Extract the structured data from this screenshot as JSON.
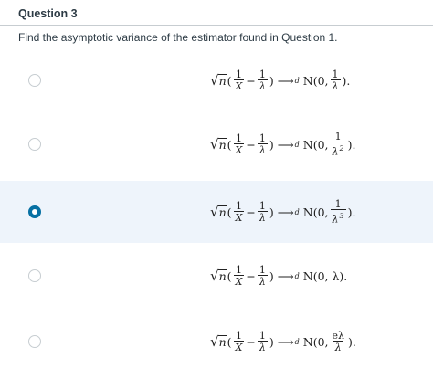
{
  "question": {
    "title": "Question 3",
    "prompt": "Find the asymptotic variance of the estimator found in Question 1."
  },
  "options": [
    {
      "selected": false,
      "lhs_num": "1",
      "lhs_den": "X",
      "minus": "−",
      "rhs_num": "1",
      "rhs_den": "λ",
      "arrow": "⟶",
      "conv": "d",
      "dist": "N(0,",
      "var_num": "1",
      "var_den": "λ",
      "var_pow": "",
      "close": ")."
    },
    {
      "selected": false,
      "lhs_num": "1",
      "lhs_den": "X",
      "minus": "−",
      "rhs_num": "1",
      "rhs_den": "λ",
      "arrow": "⟶",
      "conv": "d",
      "dist": "N(0,",
      "var_num": "1",
      "var_den": "λ",
      "var_pow": "2",
      "close": ")."
    },
    {
      "selected": true,
      "lhs_num": "1",
      "lhs_den": "X",
      "minus": "−",
      "rhs_num": "1",
      "rhs_den": "λ",
      "arrow": "⟶",
      "conv": "d",
      "dist": "N(0,",
      "var_num": "1",
      "var_den": "λ",
      "var_pow": "3",
      "close": ")."
    },
    {
      "selected": false,
      "lhs_num": "1",
      "lhs_den": "X",
      "minus": "−",
      "rhs_num": "1",
      "rhs_den": "λ",
      "arrow": "⟶",
      "conv": "d",
      "dist_plain": "N(0, λ).",
      "close": ""
    },
    {
      "selected": false,
      "lhs_num": "1",
      "lhs_den": "X",
      "minus": "−",
      "rhs_num": "1",
      "rhs_den": "λ",
      "arrow": "⟶",
      "conv": "d",
      "dist": "N(0,",
      "var_num": "eλ",
      "var_den": "λ",
      "var_pow": "",
      "close": ")."
    }
  ],
  "sqrt": {
    "radical": "√",
    "radicand": "n"
  },
  "colors": {
    "accent": "#0770a3",
    "selected_bg": "#eef4fb",
    "text": "#2d3b45"
  }
}
